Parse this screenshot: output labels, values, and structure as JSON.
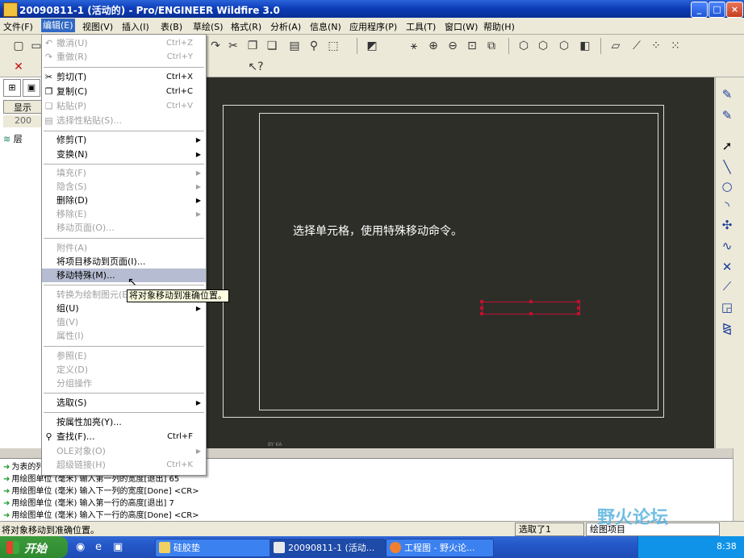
{
  "window": {
    "title": "20090811-1 (活动的) - Pro/ENGINEER Wildfire 3.0",
    "buttons": [
      "_",
      "□",
      "×"
    ]
  },
  "menubar": [
    "文件(F)",
    "编辑(E)",
    "视图(V)",
    "插入(I)",
    "表(B)",
    "草绘(S)",
    "格式(R)",
    "分析(A)",
    "信息(N)",
    "应用程序(P)",
    "工具(T)",
    "窗口(W)",
    "帮助(H)"
  ],
  "left_panel": {
    "tab_show": "显示",
    "model_prefix": "200",
    "tree_item": "层"
  },
  "edit_menu": {
    "items": [
      {
        "label": "撤消(U)",
        "shortcut": "Ctrl+Z",
        "enabled": false
      },
      {
        "label": "重做(R)",
        "shortcut": "Ctrl+Y",
        "enabled": false
      },
      {
        "label": "剪切(T)",
        "shortcut": "Ctrl+X",
        "enabled": true
      },
      {
        "label": "复制(C)",
        "shortcut": "Ctrl+C",
        "enabled": true
      },
      {
        "label": "粘贴(P)",
        "shortcut": "Ctrl+V",
        "enabled": false
      },
      {
        "label": "选择性粘贴(S)...",
        "shortcut": "",
        "enabled": false
      },
      {
        "label": "修剪(T)",
        "enabled": true
      },
      {
        "label": "变换(N)",
        "enabled": true
      },
      {
        "label": "填充(F)",
        "enabled": false
      },
      {
        "label": "隐含(S)",
        "enabled": false
      },
      {
        "label": "删除(D)",
        "enabled": true
      },
      {
        "label": "移除(E)",
        "enabled": false
      },
      {
        "label": "移动页面(O)...",
        "enabled": false
      },
      {
        "label": "附件(A)",
        "enabled": false
      },
      {
        "label": "将项目移动到页面(I)...",
        "enabled": true
      },
      {
        "label": "移动特殊(M)...",
        "enabled": true
      },
      {
        "label": "转换为绘制图元(E)",
        "enabled": false
      },
      {
        "label": "组(U)",
        "enabled": true
      },
      {
        "label": "值(V)",
        "enabled": false
      },
      {
        "label": "属性(I)",
        "enabled": false
      },
      {
        "label": "参照(E)",
        "enabled": false
      },
      {
        "label": "定义(D)",
        "enabled": false
      },
      {
        "label": "分组操作",
        "enabled": false
      },
      {
        "label": "选取(S)",
        "enabled": true
      },
      {
        "label": "按属性加亮(Y)...",
        "enabled": true
      },
      {
        "label": "查找(F)...",
        "shortcut": "Ctrl+F",
        "enabled": true
      },
      {
        "label": "OLE对象(O)",
        "enabled": false
      },
      {
        "label": "超级链接(H)",
        "shortcut": "Ctrl+K",
        "enabled": false
      }
    ],
    "tooltip": "将对象移动到准确位置。"
  },
  "canvas": {
    "message": "选择单元格，使用特殊移动命令。",
    "corner_label": "BY KA"
  },
  "messages": [
    "为表的列...",
    "用绘图单位 (毫米) 输入第一列的宽度[退出]   65",
    "用绘图单位 (毫米) 输入下一列的宽度[Done]   <CR>",
    "用绘图单位 (毫米) 输入第一行的高度[退出]   7",
    "用绘图单位 (毫米) 输入下一行的高度[Done]   <CR>"
  ],
  "status": {
    "text": "将对象移动到准确位置。",
    "selection": "选取了1",
    "filter": "绘图项目"
  },
  "taskbar": {
    "start": "开始",
    "tasks": [
      "硅胶垫",
      "20090811-1 (活动...",
      "工程图 - 野火论..."
    ],
    "clock": "8:38"
  },
  "watermark": "野火论坛",
  "colors": {
    "titlebar": "#0b3bb5",
    "canvas": "#2e2e29",
    "selection": "#c01030",
    "menu_highlight": "#b6bdd2"
  }
}
